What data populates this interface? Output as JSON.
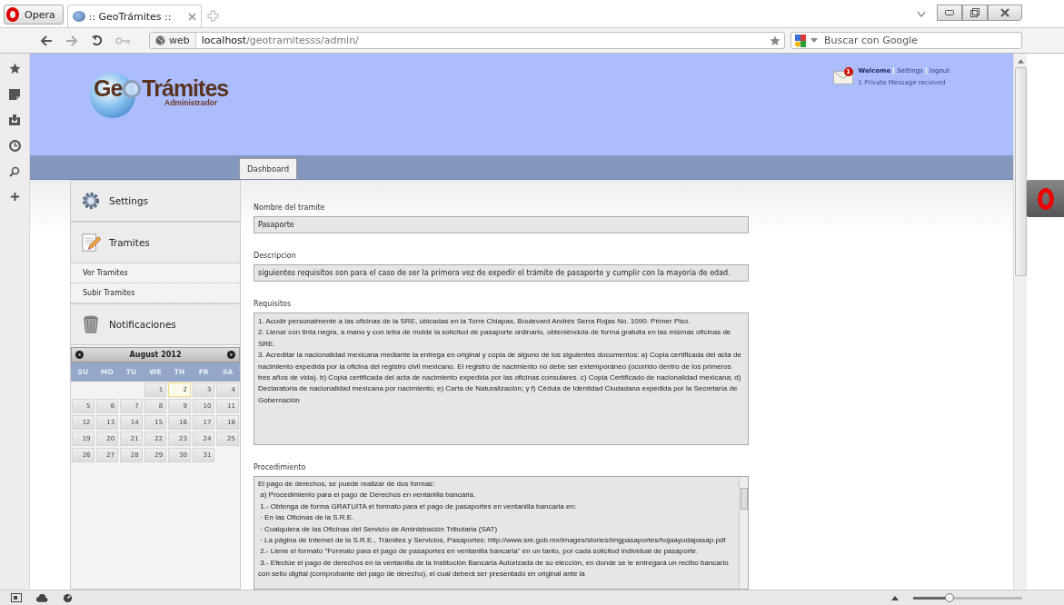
{
  "browser": {
    "menu_button": "Opera",
    "tabs": [
      {
        "title": ":: GeoTrámites ::",
        "selected": true
      }
    ],
    "address": {
      "badge": "web",
      "host": "localhost",
      "path": "/geotramitesss/admin/"
    },
    "search": {
      "placeholder": "Buscar con Google"
    },
    "zoom": {
      "level": 0.33
    }
  },
  "header": {
    "logo": {
      "part_1": "Ge",
      "part_2": "Trámites",
      "subtitle": "Administrador"
    },
    "message_badge": "1",
    "user_links": [
      "Welcome",
      "Settings",
      "logout"
    ],
    "message_notice": "1 Private Message recieved"
  },
  "nav_tabs": [
    {
      "label": "Dashboard",
      "selected": true
    }
  ],
  "sidebar": {
    "sections": [
      {
        "kind": "gear",
        "label": "Settings"
      },
      {
        "kind": "note",
        "label": "Tramites",
        "children": [
          {
            "label": "Ver Tramites"
          },
          {
            "label": "Subir Tramites"
          }
        ]
      },
      {
        "kind": "trash",
        "label": "Notificaciones"
      }
    ]
  },
  "calendar": {
    "month": "August 2012",
    "weekdays": [
      "SU",
      "MO",
      "TU",
      "WE",
      "TH",
      "FR",
      "SA"
    ],
    "weeks": [
      [
        {
          "day": "1",
          "today": false
        },
        {
          "day": "2",
          "today": true
        },
        {
          "day": "3",
          "today": false
        },
        {
          "day": "4",
          "today": false
        }
      ],
      [
        {
          "day": "5",
          "today": false
        },
        {
          "day": "6",
          "today": false
        },
        {
          "day": "7",
          "today": false
        },
        {
          "day": "8",
          "today": false
        },
        {
          "day": "9",
          "today": false
        },
        {
          "day": "10",
          "today": false
        },
        {
          "day": "11",
          "today": false
        }
      ],
      [
        {
          "day": "12",
          "today": false
        },
        {
          "day": "13",
          "today": false
        },
        {
          "day": "14",
          "today": false
        },
        {
          "day": "15",
          "today": false
        },
        {
          "day": "16",
          "today": false
        },
        {
          "day": "17",
          "today": false
        },
        {
          "day": "18",
          "today": false
        }
      ],
      [
        {
          "day": "19",
          "today": false
        },
        {
          "day": "20",
          "today": false
        },
        {
          "day": "21",
          "today": false
        },
        {
          "day": "22",
          "today": false
        },
        {
          "day": "23",
          "today": false
        },
        {
          "day": "24",
          "today": false
        },
        {
          "day": "25",
          "today": false
        }
      ],
      [
        {
          "day": "26",
          "today": false
        },
        {
          "day": "27",
          "today": false
        },
        {
          "day": "28",
          "today": false
        },
        {
          "day": "29",
          "today": false
        },
        {
          "day": "30",
          "today": false
        },
        {
          "day": "31",
          "today": false
        }
      ]
    ]
  },
  "form": {
    "fields": [
      {
        "kind": "line",
        "label": "Nombre del tramite",
        "value": "Pasaporte"
      },
      {
        "kind": "line",
        "label": "Descripcion",
        "value": "siguientes requisitos son para el caso de ser la primera vez de expedir el trámite de pasaporte y cumplir con la mayoría de edad."
      },
      {
        "kind": "area",
        "label": "Requisitos",
        "value": "1. Acudir personalmente a las oficinas de la SRE, ubicadas en la Torre Chiapas, Boulevard Andrés Serra Rojas No. 1090. Primer Piso.\n2. Llenar con tinta negra, a mano y con letra de molde la solicitud de pasaporte ordinario, obteniéndola de forma gratuita en las mismas oficinas de SRE.\n3. Acreditar la nacionalidad mexicana mediante la entrega en original y copia de alguno de los siguientes documentos: a) Copia certificada del acta de nacimiento expedida por la oficina del registro civil mexicano. El registro de nacimiento no debe ser extemporáneo (ocurrido dentro de los primeros tres años de vida). b) Copia certificada del acta de nacimiento expedida por las oficinas consulares. c) Copia Certificado de nacionalidad mexicana; d) Declaratoria de nacionalidad mexicana por nacimiento; e) Carta de Naturalización; y f) Cédula de Identidad Ciudadana expedida por la Secretaría de Gobernación"
      },
      {
        "kind": "scroll",
        "label": "Procedimiento",
        "value": "El pago de derechos, se puede realizar de dos formas:\n a) Procedimiento para el pago de Derechos en ventanilla bancaria.\n 1.- Obtenga de forma GRATUITA el formato para el pago de pasaportes en ventanilla bancaria en:\n · En las Oficinas de la S.R.E.\n · Cualquiera de las Oficinas del Servicio de Aministración Tributaria (SAT)\n · La página de Internet de la S.R.E., Trámites y Servicios, Pasaportes: http://www.sre.gob.mx/images/stories/imgpasaportes/hojaayudapasap.pdf\n 2.- Llene el formato \"Formato para el pago de pasaportes en ventanilla bancaria\" en un tanto, por cada solicitud individual de pasaporte.\n 3.- Efectúe el pago de derechos en la ventanilla de la Institución Bancaria Autorizada de su elección, en donde se le entregará un recibo bancario con sello digital (comprobante del pago de derecho), el cual deberá ser presentado en original ante la"
      }
    ]
  }
}
